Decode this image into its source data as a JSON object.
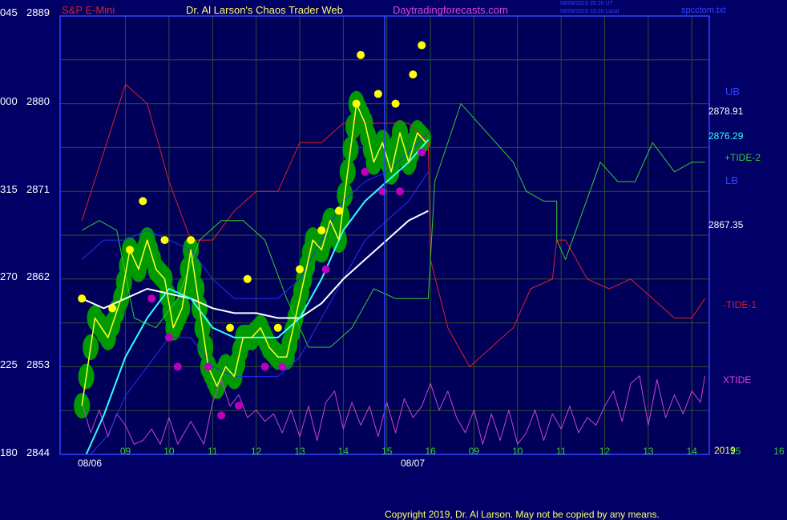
{
  "header": {
    "instrument": "S&P E-Mini",
    "title": "Dr. Al Larson's Chaos Trader Web",
    "site": "Daytradingforecasts.com",
    "ut_time": "08/06/2019 20:20 UT",
    "local_time": "08/06/2019 15:20 Local",
    "file": "spcctom.txt"
  },
  "footer": {
    "copyright": "Copyright 2019, Dr. Al Larson. May not be copied by any means."
  },
  "colors": {
    "background": "#000066",
    "plot_background": "#00005a",
    "grid": "#2f4f2f",
    "ub_label": "#3344ff",
    "lb_label": "#3344ff",
    "tide_plus": "#33cc33",
    "tide_minus": "#dd2222",
    "xtide": "#cc44cc",
    "price": "#ffff33",
    "ma_fast": "#33ffff",
    "ma_slow": "#ffffff",
    "band": "#2233ee",
    "bubble": "#009900",
    "marker_high": "#ffff00",
    "marker_low": "#bb00bb"
  },
  "chart_data": {
    "type": "line",
    "y_axis": {
      "ticks": [
        {
          "left": "180",
          "price": "2844",
          "value": 2844
        },
        {
          "left": "225",
          "price": "2853",
          "value": 2853
        },
        {
          "left": "270",
          "price": "2862",
          "value": 2862
        },
        {
          "left": "315",
          "price": "2871",
          "value": 2871
        },
        {
          "left": "000",
          "price": "2880",
          "value": 2880
        },
        {
          "left": "045",
          "price": "2889",
          "value": 2889
        }
      ],
      "ylim": [
        2844,
        2889
      ]
    },
    "x_axis": {
      "hour_ticks": [
        "09",
        "10",
        "11",
        "12",
        "13",
        "14",
        "15",
        "16",
        "09",
        "10",
        "11",
        "12",
        "13",
        "14",
        "15",
        "16"
      ],
      "dates": [
        "08/06",
        "08/07"
      ],
      "year": "2019"
    },
    "right_labels": {
      "ub": "UB",
      "ub_value": "2878.91",
      "ma_value": "2876.29",
      "tide_plus": "+TIDE-2",
      "lb": "LB",
      "lb_value": "2867.35",
      "tide_minus": "-TIDE-1",
      "xtide": "XTIDE"
    },
    "price_series": [
      {
        "h": 8.0,
        "v": 2849
      },
      {
        "h": 8.3,
        "v": 2858
      },
      {
        "h": 8.6,
        "v": 2856
      },
      {
        "h": 8.9,
        "v": 2860
      },
      {
        "h": 9.1,
        "v": 2865
      },
      {
        "h": 9.3,
        "v": 2863
      },
      {
        "h": 9.5,
        "v": 2866
      },
      {
        "h": 9.7,
        "v": 2863
      },
      {
        "h": 9.9,
        "v": 2862
      },
      {
        "h": 10.1,
        "v": 2857
      },
      {
        "h": 10.3,
        "v": 2859
      },
      {
        "h": 10.5,
        "v": 2865
      },
      {
        "h": 10.7,
        "v": 2859
      },
      {
        "h": 10.9,
        "v": 2853
      },
      {
        "h": 11.1,
        "v": 2851
      },
      {
        "h": 11.3,
        "v": 2853
      },
      {
        "h": 11.5,
        "v": 2852
      },
      {
        "h": 11.7,
        "v": 2856
      },
      {
        "h": 11.9,
        "v": 2856
      },
      {
        "h": 12.1,
        "v": 2857
      },
      {
        "h": 12.3,
        "v": 2855
      },
      {
        "h": 12.5,
        "v": 2854
      },
      {
        "h": 12.7,
        "v": 2854
      },
      {
        "h": 12.9,
        "v": 2858
      },
      {
        "h": 13.1,
        "v": 2862
      },
      {
        "h": 13.3,
        "v": 2866
      },
      {
        "h": 13.5,
        "v": 2865
      },
      {
        "h": 13.7,
        "v": 2868
      },
      {
        "h": 13.9,
        "v": 2866
      },
      {
        "h": 14.1,
        "v": 2873
      },
      {
        "h": 14.3,
        "v": 2880
      },
      {
        "h": 14.5,
        "v": 2878
      },
      {
        "h": 14.7,
        "v": 2874
      },
      {
        "h": 14.9,
        "v": 2876
      },
      {
        "h": 15.1,
        "v": 2873
      },
      {
        "h": 15.3,
        "v": 2877
      },
      {
        "h": 15.5,
        "v": 2874
      },
      {
        "h": 15.7,
        "v": 2877
      },
      {
        "h": 15.9,
        "v": 2876
      }
    ],
    "ma_fast": [
      {
        "h": 8.1,
        "v": 2844
      },
      {
        "h": 8.5,
        "v": 2848
      },
      {
        "h": 9.0,
        "v": 2854
      },
      {
        "h": 9.5,
        "v": 2858
      },
      {
        "h": 10.0,
        "v": 2861
      },
      {
        "h": 10.5,
        "v": 2860
      },
      {
        "h": 11.0,
        "v": 2857
      },
      {
        "h": 11.5,
        "v": 2856
      },
      {
        "h": 12.0,
        "v": 2856
      },
      {
        "h": 12.5,
        "v": 2856
      },
      {
        "h": 13.0,
        "v": 2858
      },
      {
        "h": 13.5,
        "v": 2862
      },
      {
        "h": 14.0,
        "v": 2867
      },
      {
        "h": 14.5,
        "v": 2870
      },
      {
        "h": 15.0,
        "v": 2872
      },
      {
        "h": 15.5,
        "v": 2874
      },
      {
        "h": 15.95,
        "v": 2876.3
      }
    ],
    "ma_slow": [
      {
        "h": 8.0,
        "v": 2860
      },
      {
        "h": 8.5,
        "v": 2859
      },
      {
        "h": 9.0,
        "v": 2860
      },
      {
        "h": 9.5,
        "v": 2861
      },
      {
        "h": 10.0,
        "v": 2860.5
      },
      {
        "h": 10.5,
        "v": 2860
      },
      {
        "h": 11.0,
        "v": 2859
      },
      {
        "h": 11.5,
        "v": 2858.5
      },
      {
        "h": 12.0,
        "v": 2858.5
      },
      {
        "h": 12.5,
        "v": 2858
      },
      {
        "h": 13.0,
        "v": 2858
      },
      {
        "h": 13.5,
        "v": 2859.5
      },
      {
        "h": 14.0,
        "v": 2862
      },
      {
        "h": 14.5,
        "v": 2864
      },
      {
        "h": 15.0,
        "v": 2866
      },
      {
        "h": 15.5,
        "v": 2868
      },
      {
        "h": 15.95,
        "v": 2869
      }
    ],
    "tide_plus_series": [
      {
        "h": 8.0,
        "v": 2867
      },
      {
        "h": 8.4,
        "v": 2868
      },
      {
        "h": 8.8,
        "v": 2867
      },
      {
        "h": 9.2,
        "v": 2858
      },
      {
        "h": 9.7,
        "v": 2857
      },
      {
        "h": 10.2,
        "v": 2860
      },
      {
        "h": 10.7,
        "v": 2866
      },
      {
        "h": 11.2,
        "v": 2868
      },
      {
        "h": 11.7,
        "v": 2868
      },
      {
        "h": 12.2,
        "v": 2866
      },
      {
        "h": 12.7,
        "v": 2860
      },
      {
        "h": 13.2,
        "v": 2855
      },
      {
        "h": 13.7,
        "v": 2855
      },
      {
        "h": 14.2,
        "v": 2857
      },
      {
        "h": 14.7,
        "v": 2861
      },
      {
        "h": 15.2,
        "v": 2860
      },
      {
        "h": 15.95,
        "v": 2860
      },
      {
        "h": 16.1,
        "v": 2872
      },
      {
        "h": 16.7,
        "v": 2880
      },
      {
        "h": 17.3,
        "v": 2877
      },
      {
        "h": 17.9,
        "v": 2874
      },
      {
        "h": 18.2,
        "v": 2871
      },
      {
        "h": 18.6,
        "v": 2870
      },
      {
        "h": 18.9,
        "v": 2870
      },
      {
        "h": 18.9,
        "v": 2866
      },
      {
        "h": 19.1,
        "v": 2864
      },
      {
        "h": 19.5,
        "v": 2869
      },
      {
        "h": 19.9,
        "v": 2874
      },
      {
        "h": 20.3,
        "v": 2872
      },
      {
        "h": 20.7,
        "v": 2872
      },
      {
        "h": 21.1,
        "v": 2876
      },
      {
        "h": 21.6,
        "v": 2873
      },
      {
        "h": 22.0,
        "v": 2874
      },
      {
        "h": 22.3,
        "v": 2874
      }
    ],
    "tide_minus_series": [
      {
        "h": 8.0,
        "v": 2868
      },
      {
        "h": 8.5,
        "v": 2875
      },
      {
        "h": 9.0,
        "v": 2882
      },
      {
        "h": 9.5,
        "v": 2880
      },
      {
        "h": 10.0,
        "v": 2872
      },
      {
        "h": 10.5,
        "v": 2866
      },
      {
        "h": 11.0,
        "v": 2866
      },
      {
        "h": 11.5,
        "v": 2869
      },
      {
        "h": 12.0,
        "v": 2871
      },
      {
        "h": 12.5,
        "v": 2871
      },
      {
        "h": 13.0,
        "v": 2876
      },
      {
        "h": 13.5,
        "v": 2876
      },
      {
        "h": 14.0,
        "v": 2878
      },
      {
        "h": 14.5,
        "v": 2878
      },
      {
        "h": 15.0,
        "v": 2878
      },
      {
        "h": 15.5,
        "v": 2878
      },
      {
        "h": 15.95,
        "v": 2876
      },
      {
        "h": 16.0,
        "v": 2864
      },
      {
        "h": 16.4,
        "v": 2857
      },
      {
        "h": 16.9,
        "v": 2853
      },
      {
        "h": 17.4,
        "v": 2855
      },
      {
        "h": 17.9,
        "v": 2857
      },
      {
        "h": 18.3,
        "v": 2861
      },
      {
        "h": 18.8,
        "v": 2862
      },
      {
        "h": 18.9,
        "v": 2866
      },
      {
        "h": 19.1,
        "v": 2866
      },
      {
        "h": 19.6,
        "v": 2862
      },
      {
        "h": 20.1,
        "v": 2861
      },
      {
        "h": 20.6,
        "v": 2862
      },
      {
        "h": 21.1,
        "v": 2860
      },
      {
        "h": 21.6,
        "v": 2858
      },
      {
        "h": 22.0,
        "v": 2858
      },
      {
        "h": 22.3,
        "v": 2860
      }
    ],
    "ub_series": [
      {
        "h": 8.0,
        "v": 2864
      },
      {
        "h": 8.5,
        "v": 2866
      },
      {
        "h": 9.0,
        "v": 2866
      },
      {
        "h": 9.5,
        "v": 2867
      },
      {
        "h": 10.0,
        "v": 2866
      },
      {
        "h": 10.5,
        "v": 2865
      },
      {
        "h": 11.0,
        "v": 2862
      },
      {
        "h": 11.5,
        "v": 2860
      },
      {
        "h": 12.0,
        "v": 2860
      },
      {
        "h": 12.5,
        "v": 2860
      },
      {
        "h": 13.0,
        "v": 2862
      },
      {
        "h": 13.5,
        "v": 2866
      },
      {
        "h": 14.0,
        "v": 2870
      },
      {
        "h": 14.5,
        "v": 2872
      },
      {
        "h": 15.0,
        "v": 2873
      },
      {
        "h": 15.5,
        "v": 2875
      },
      {
        "h": 15.95,
        "v": 2877
      }
    ],
    "lb_series": [
      {
        "h": 8.2,
        "v": 2844
      },
      {
        "h": 8.6,
        "v": 2846
      },
      {
        "h": 9.0,
        "v": 2850
      },
      {
        "h": 9.5,
        "v": 2853
      },
      {
        "h": 10.0,
        "v": 2856
      },
      {
        "h": 10.5,
        "v": 2856
      },
      {
        "h": 11.0,
        "v": 2853
      },
      {
        "h": 11.5,
        "v": 2852
      },
      {
        "h": 12.0,
        "v": 2852
      },
      {
        "h": 12.5,
        "v": 2852
      },
      {
        "h": 13.0,
        "v": 2854
      },
      {
        "h": 13.5,
        "v": 2858
      },
      {
        "h": 14.0,
        "v": 2862
      },
      {
        "h": 14.5,
        "v": 2866
      },
      {
        "h": 15.0,
        "v": 2868
      },
      {
        "h": 15.5,
        "v": 2870
      },
      {
        "h": 15.95,
        "v": 2873
      }
    ],
    "high_markers": [
      {
        "h": 8.0,
        "v": 2860
      },
      {
        "h": 8.7,
        "v": 2859
      },
      {
        "h": 9.1,
        "v": 2865
      },
      {
        "h": 9.4,
        "v": 2870
      },
      {
        "h": 9.9,
        "v": 2866
      },
      {
        "h": 10.5,
        "v": 2866
      },
      {
        "h": 11.4,
        "v": 2857
      },
      {
        "h": 11.8,
        "v": 2862
      },
      {
        "h": 12.5,
        "v": 2857
      },
      {
        "h": 13.0,
        "v": 2863
      },
      {
        "h": 13.5,
        "v": 2867
      },
      {
        "h": 13.9,
        "v": 2869
      },
      {
        "h": 14.3,
        "v": 2880
      },
      {
        "h": 14.4,
        "v": 2885
      },
      {
        "h": 14.8,
        "v": 2881
      },
      {
        "h": 15.2,
        "v": 2880
      },
      {
        "h": 15.6,
        "v": 2883
      },
      {
        "h": 15.8,
        "v": 2886
      }
    ],
    "low_markers": [
      {
        "h": 9.6,
        "v": 2860
      },
      {
        "h": 10.0,
        "v": 2856
      },
      {
        "h": 10.2,
        "v": 2853
      },
      {
        "h": 10.9,
        "v": 2853
      },
      {
        "h": 11.2,
        "v": 2848
      },
      {
        "h": 11.6,
        "v": 2849
      },
      {
        "h": 12.2,
        "v": 2853
      },
      {
        "h": 12.6,
        "v": 2853
      },
      {
        "h": 13.6,
        "v": 2863
      },
      {
        "h": 14.5,
        "v": 2873
      },
      {
        "h": 14.9,
        "v": 2871
      },
      {
        "h": 15.3,
        "v": 2871
      },
      {
        "h": 15.8,
        "v": 2875
      }
    ],
    "xtide_series": [
      {
        "h": 8.0,
        "v": 0.6
      },
      {
        "h": 8.2,
        "v": 0.2
      },
      {
        "h": 8.4,
        "v": 0.5
      },
      {
        "h": 8.6,
        "v": 0.15
      },
      {
        "h": 8.8,
        "v": 0.45
      },
      {
        "h": 9.0,
        "v": 0.3
      },
      {
        "h": 9.2,
        "v": 0.05
      },
      {
        "h": 9.4,
        "v": 0.1
      },
      {
        "h": 9.6,
        "v": 0.25
      },
      {
        "h": 9.8,
        "v": 0.05
      },
      {
        "h": 10.0,
        "v": 0.4
      },
      {
        "h": 10.2,
        "v": 0.05
      },
      {
        "h": 10.5,
        "v": 0.35
      },
      {
        "h": 10.8,
        "v": 0.05
      },
      {
        "h": 11.0,
        "v": 0.6
      },
      {
        "h": 11.2,
        "v": 0.9
      },
      {
        "h": 11.4,
        "v": 0.55
      },
      {
        "h": 11.6,
        "v": 0.7
      },
      {
        "h": 11.8,
        "v": 0.4
      },
      {
        "h": 12.0,
        "v": 0.5
      },
      {
        "h": 12.2,
        "v": 0.35
      },
      {
        "h": 12.4,
        "v": 0.45
      },
      {
        "h": 12.6,
        "v": 0.2
      },
      {
        "h": 12.8,
        "v": 0.5
      },
      {
        "h": 13.0,
        "v": 0.15
      },
      {
        "h": 13.2,
        "v": 0.55
      },
      {
        "h": 13.4,
        "v": 0.1
      },
      {
        "h": 13.6,
        "v": 0.6
      },
      {
        "h": 13.8,
        "v": 0.75
      },
      {
        "h": 14.0,
        "v": 0.25
      },
      {
        "h": 14.2,
        "v": 0.6
      },
      {
        "h": 14.4,
        "v": 0.3
      },
      {
        "h": 14.6,
        "v": 0.55
      },
      {
        "h": 14.8,
        "v": 0.15
      },
      {
        "h": 15.0,
        "v": 0.6
      },
      {
        "h": 15.2,
        "v": 0.2
      },
      {
        "h": 15.4,
        "v": 0.65
      },
      {
        "h": 15.6,
        "v": 0.4
      },
      {
        "h": 15.8,
        "v": 0.55
      },
      {
        "h": 16.0,
        "v": 0.85
      },
      {
        "h": 16.2,
        "v": 0.5
      },
      {
        "h": 16.4,
        "v": 0.75
      },
      {
        "h": 16.6,
        "v": 0.4
      },
      {
        "h": 16.8,
        "v": 0.2
      },
      {
        "h": 17.0,
        "v": 0.5
      },
      {
        "h": 17.2,
        "v": 0.05
      },
      {
        "h": 17.4,
        "v": 0.45
      },
      {
        "h": 17.6,
        "v": 0.1
      },
      {
        "h": 17.8,
        "v": 0.5
      },
      {
        "h": 18.0,
        "v": 0.05
      },
      {
        "h": 18.2,
        "v": 0.2
      },
      {
        "h": 18.4,
        "v": 0.5
      },
      {
        "h": 18.6,
        "v": 0.1
      },
      {
        "h": 18.8,
        "v": 0.45
      },
      {
        "h": 19.0,
        "v": 0.25
      },
      {
        "h": 19.2,
        "v": 0.55
      },
      {
        "h": 19.4,
        "v": 0.2
      },
      {
        "h": 19.6,
        "v": 0.4
      },
      {
        "h": 19.8,
        "v": 0.3
      },
      {
        "h": 20.0,
        "v": 0.55
      },
      {
        "h": 20.2,
        "v": 0.75
      },
      {
        "h": 20.4,
        "v": 0.35
      },
      {
        "h": 20.6,
        "v": 0.85
      },
      {
        "h": 20.8,
        "v": 0.95
      },
      {
        "h": 21.0,
        "v": 0.3
      },
      {
        "h": 21.2,
        "v": 0.9
      },
      {
        "h": 21.4,
        "v": 0.4
      },
      {
        "h": 21.6,
        "v": 0.7
      },
      {
        "h": 21.8,
        "v": 0.45
      },
      {
        "h": 22.0,
        "v": 0.75
      },
      {
        "h": 22.2,
        "v": 0.6
      },
      {
        "h": 22.3,
        "v": 0.95
      }
    ]
  }
}
